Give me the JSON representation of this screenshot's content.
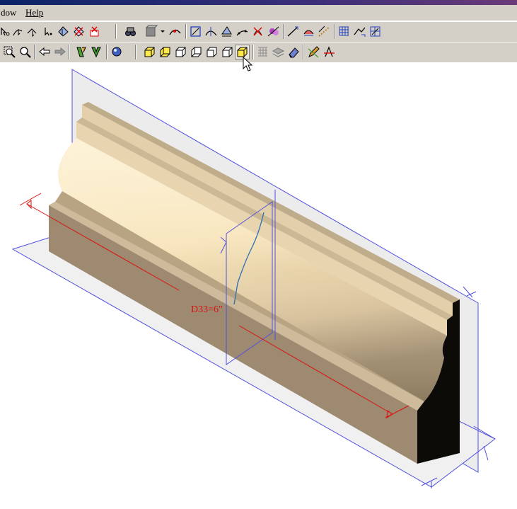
{
  "menu": {
    "window_label": "dow",
    "help_label": "Help"
  },
  "toolbar1": {
    "icons": [
      "select-point-icon",
      "select-curve-icon",
      "select-edge-icon",
      "select-arrow-icon",
      "select-face-icon",
      "deselect-icon",
      "delete-select-icon",
      "binoculars-icon",
      "shaded-box-icon",
      "dropdown-arrow-icon",
      "curve-tool-icon",
      "curve-a-icon",
      "curve-b-icon",
      "curve-c-icon",
      "curve-d-icon",
      "curve-e-icon",
      "curve-f-icon",
      "curve-g-icon",
      "curve-h-icon",
      "curve-i-icon",
      "grid-a-icon",
      "grid-b-icon",
      "grid-c-icon"
    ]
  },
  "toolbar2": {
    "icons": [
      "zoom-window-icon",
      "zoom-icon",
      "back-arrow-icon",
      "forward-arrow-icon",
      "sweep-green-icon",
      "sweep-yellow-icon",
      "render-icon",
      "view-iso-1-icon",
      "view-iso-2-icon",
      "view-front-icon",
      "view-back-icon",
      "view-side-1-icon",
      "view-side-2-icon",
      "view-shaded-icon",
      "hatch-icon",
      "layers-icon",
      "eraser-icon",
      "pencil-icon",
      "measure-icon"
    ]
  },
  "viewport": {
    "dimension_label": "D33=6\"",
    "colors": {
      "molding_top": "#f5e2b8",
      "molding_side": "#9d8a71",
      "molding_front": "#c6b597",
      "molding_end": "#0d0b08",
      "plane_fill": "#ececec",
      "plane_edge": "#5050e0",
      "dimension": "#dd1111"
    }
  }
}
